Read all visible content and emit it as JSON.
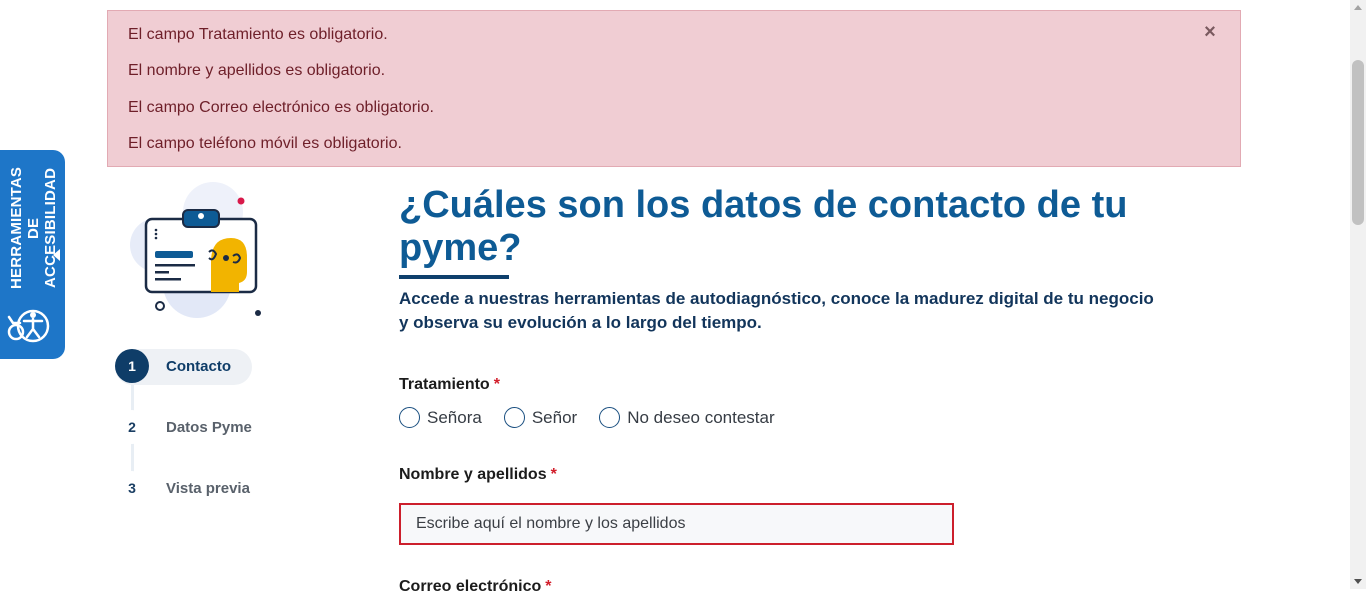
{
  "alert": {
    "messages": [
      "El campo Tratamiento es obligatorio.",
      "El nombre y apellidos es obligatorio.",
      "El campo Correo electrónico es obligatorio.",
      "El campo teléfono móvil es obligatorio."
    ],
    "close_label": "×"
  },
  "accessibility": {
    "label": "HERRAMIENTAS DE ACCESIBILIDAD",
    "icon": "accessibility-icon"
  },
  "steps": [
    {
      "number": "1",
      "label": "Contacto",
      "active": true
    },
    {
      "number": "2",
      "label": "Datos Pyme",
      "active": false
    },
    {
      "number": "3",
      "label": "Vista previa",
      "active": false
    }
  ],
  "main": {
    "title": "¿Cuáles son los datos de contacto de tu pyme?",
    "subtitle": "Accede a nuestras herramientas de autodiagnóstico, conoce la madurez digital de tu negocio y observa su evolución a lo largo del tiempo."
  },
  "form": {
    "treatment": {
      "label": "Tratamiento",
      "required_mark": "*",
      "options": [
        "Señora",
        "Señor",
        "No deseo contestar"
      ]
    },
    "name": {
      "label": "Nombre y apellidos",
      "required_mark": "*",
      "value": "",
      "placeholder": "Escribe aquí el nombre y los apellidos"
    },
    "email": {
      "label": "Correo electrónico",
      "required_mark": "*"
    }
  },
  "colors": {
    "alert_bg": "#f0cdd3",
    "alert_text": "#6e1f29",
    "accessibility_tab": "#1e76c8",
    "title": "#0e5b95",
    "active_step": "#0f3d68",
    "required": "#d21e2b",
    "error_border": "#cc1f2c"
  }
}
